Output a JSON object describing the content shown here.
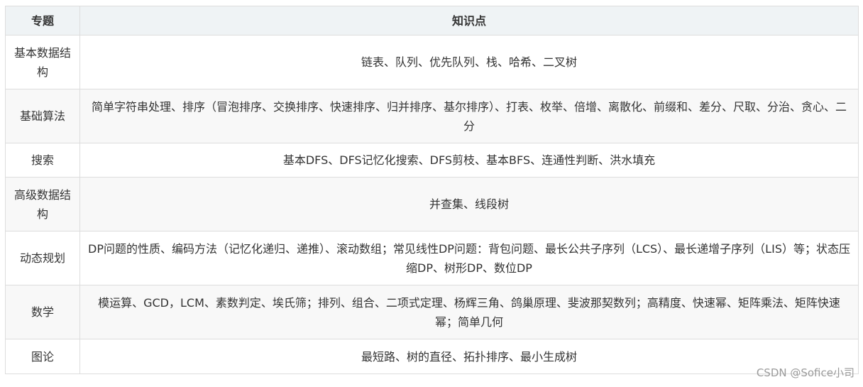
{
  "table": {
    "headers": {
      "topic": "专题",
      "points": "知识点"
    },
    "rows": [
      {
        "topic": "基本数据结构",
        "points": "链表、队列、优先队列、栈、哈希、二叉树"
      },
      {
        "topic": "基础算法",
        "points": "简单字符串处理、排序（冒泡排序、交换排序、快速排序、归并排序、基尔排序）、打表、枚举、倍增、离散化、前缀和、差分、尺取、分治、贪心、二分"
      },
      {
        "topic": "搜索",
        "points": "基本DFS、DFS记忆化搜索、DFS剪枝、基本BFS、连通性判断、洪水填充"
      },
      {
        "topic": "高级数据结构",
        "points": "并查集、线段树"
      },
      {
        "topic": "动态规划",
        "points": "DP问题的性质、编码方法（记忆化递归、递推）、滚动数组；常见线性DP问题：背包问题、最长公共子序列（LCS）、最长递增子序列（LIS）等；状态压缩DP、树形DP、数位DP"
      },
      {
        "topic": "数学",
        "points": "模运算、GCD，LCM、素数判定、埃氏筛；排列、组合、二项式定理、杨辉三角、鸽巢原理、斐波那契数列；高精度、快速幂、矩阵乘法、矩阵快速幂；简单几何"
      },
      {
        "topic": "图论",
        "points": "最短路、树的直径、拓扑排序、最小生成树"
      }
    ]
  },
  "watermark": "CSDN @Sofice小司"
}
